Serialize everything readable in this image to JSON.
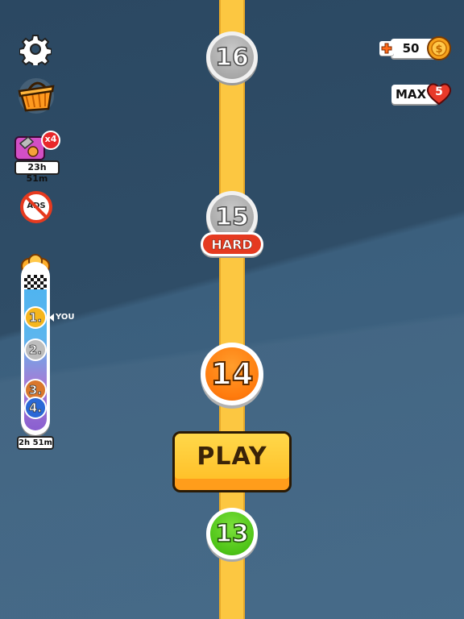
{
  "levels": [
    {
      "number": "16",
      "state": "locked"
    },
    {
      "number": "15",
      "state": "locked",
      "badge": "HARD"
    },
    {
      "number": "14",
      "state": "current"
    },
    {
      "number": "13",
      "state": "completed"
    }
  ],
  "play_button": {
    "label": "PLAY"
  },
  "coins": {
    "value": "50",
    "add_icon": "plus-icon",
    "icon": "coin-icon"
  },
  "lives": {
    "label": "MAX",
    "count": "5",
    "icon": "heart-icon"
  },
  "left_menu": {
    "settings": {
      "icon": "gear-icon"
    },
    "shop": {
      "icon": "shop-basket-icon"
    },
    "offer": {
      "icon": "boost-offer-icon",
      "multiplier": "x4",
      "timer": "23h 51m"
    },
    "no_ads": {
      "icon": "no-ads-icon",
      "label": "ADS"
    }
  },
  "leaderboard": {
    "icon": "trophy-icon",
    "you_label": "YOU",
    "positions": [
      {
        "rank": "1.",
        "color": "#f5b61e"
      },
      {
        "rank": "2.",
        "color": "#bdbdbd"
      },
      {
        "rank": "3.",
        "color": "#d9772d"
      },
      {
        "rank": "4.",
        "color": "#2a68d6"
      }
    ],
    "timer": "2h 51m"
  },
  "colors": {
    "background": "#2f4d67",
    "track": "#fcc741",
    "current_level": "#ff7b0d",
    "completed_level": "#4ec417",
    "locked_level": "#a9a9a9",
    "hard_badge": "#e53a20",
    "play_button": "#ffc12a"
  }
}
